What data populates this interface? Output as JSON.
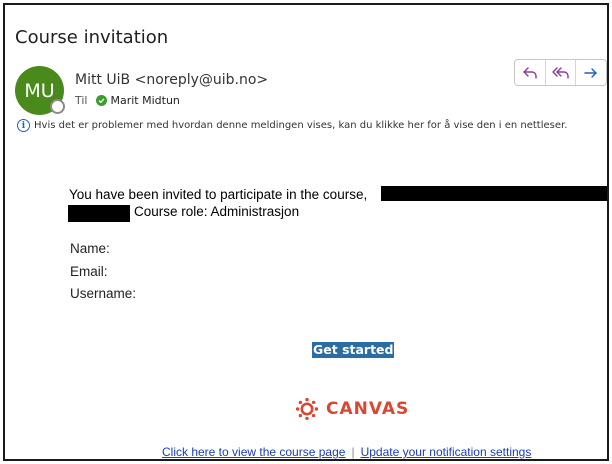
{
  "email": {
    "subject": "Course invitation",
    "avatar_initials": "MU",
    "sender": "Mitt UiB <noreply@uib.no>",
    "to_label": "Til",
    "recipient": "Marit Midtun",
    "info_message": "Hvis det er problemer med hvordan denne meldingen vises, kan du klikke her for å vise den i en nettleser."
  },
  "actions": {
    "reply": "reply-icon",
    "reply_all": "reply-all-icon",
    "forward": "forward-icon"
  },
  "body": {
    "invite_text": "You have been invited to participate in the course,",
    "course_role": "Course role: Administrasjon",
    "fields": {
      "name_label": "Name:",
      "email_label": "Email:",
      "username_label": "Username:"
    },
    "get_started": "Get started",
    "brand": "CANVAS"
  },
  "footer": {
    "course_page_link": "Click here to view the course page",
    "separator": "|",
    "notification_link": "Update your notification settings"
  },
  "colors": {
    "avatar": "#4a8a1c",
    "accent": "#8c3d96",
    "forward": "#1b63b5",
    "button": "#2b6ca3",
    "canvas_brand": "#d64933",
    "link": "#1a3db3"
  }
}
